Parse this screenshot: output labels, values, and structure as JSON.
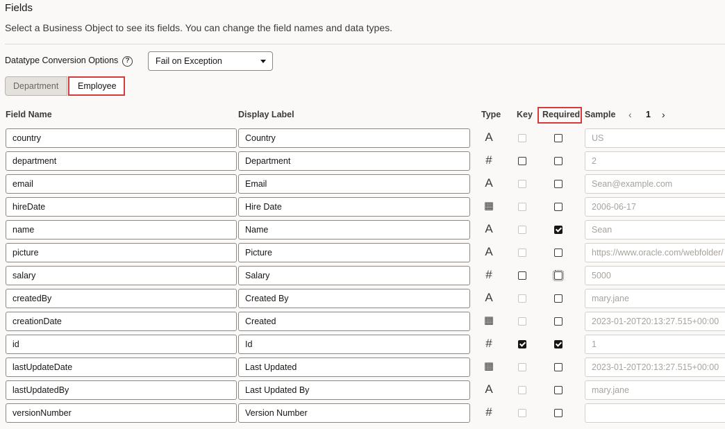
{
  "header": {
    "title": "Fields",
    "description": "Select a Business Object to see its fields. You can change the field names and data types."
  },
  "conversion": {
    "label": "Datatype Conversion Options",
    "help_icon": "?",
    "selected": "Fail on Exception"
  },
  "tabs": [
    {
      "label": "Department",
      "active": false
    },
    {
      "label": "Employee",
      "active": true
    }
  ],
  "columns": {
    "field_name": "Field Name",
    "display_label": "Display Label",
    "type": "Type",
    "key": "Key",
    "required": "Required",
    "sample": "Sample"
  },
  "pager": {
    "prev": "‹",
    "page": "1",
    "next": "›"
  },
  "rows": [
    {
      "name": "country",
      "label": "Country",
      "type": "text-icon",
      "key": "disabled",
      "required": "unchecked",
      "sample": "US"
    },
    {
      "name": "department",
      "label": "Department",
      "type": "number-icon",
      "key": "unchecked",
      "required": "unchecked",
      "sample": "2"
    },
    {
      "name": "email",
      "label": "Email",
      "type": "text-icon",
      "key": "disabled",
      "required": "unchecked",
      "sample": "Sean@example.com"
    },
    {
      "name": "hireDate",
      "label": "Hire Date",
      "type": "date-icon",
      "key": "disabled",
      "required": "unchecked",
      "sample": "2006-06-17"
    },
    {
      "name": "name",
      "label": "Name",
      "type": "text-icon",
      "key": "disabled",
      "required": "checked",
      "sample": "Sean"
    },
    {
      "name": "picture",
      "label": "Picture",
      "type": "text-icon",
      "key": "disabled",
      "required": "unchecked",
      "sample": "https://www.oracle.com/webfolder/"
    },
    {
      "name": "salary",
      "label": "Salary",
      "type": "number-icon",
      "key": "unchecked",
      "required": "focus",
      "sample": "5000"
    },
    {
      "name": "createdBy",
      "label": "Created By",
      "type": "text-icon",
      "key": "disabled",
      "required": "unchecked",
      "sample": "mary.jane"
    },
    {
      "name": "creationDate",
      "label": "Created",
      "type": "datetime-icon",
      "key": "disabled",
      "required": "unchecked",
      "sample": "2023-01-20T20:13:27.515+00:00"
    },
    {
      "name": "id",
      "label": "Id",
      "type": "number-icon",
      "key": "checked",
      "required": "checked",
      "sample": "1"
    },
    {
      "name": "lastUpdateDate",
      "label": "Last Updated",
      "type": "datetime-icon",
      "key": "disabled",
      "required": "unchecked",
      "sample": "2023-01-20T20:13:27.515+00:00"
    },
    {
      "name": "lastUpdatedBy",
      "label": "Last Updated By",
      "type": "text-icon",
      "key": "disabled",
      "required": "unchecked",
      "sample": "mary.jane"
    },
    {
      "name": "versionNumber",
      "label": "Version Number",
      "type": "number-icon",
      "key": "disabled",
      "required": "unchecked",
      "sample": ""
    }
  ]
}
